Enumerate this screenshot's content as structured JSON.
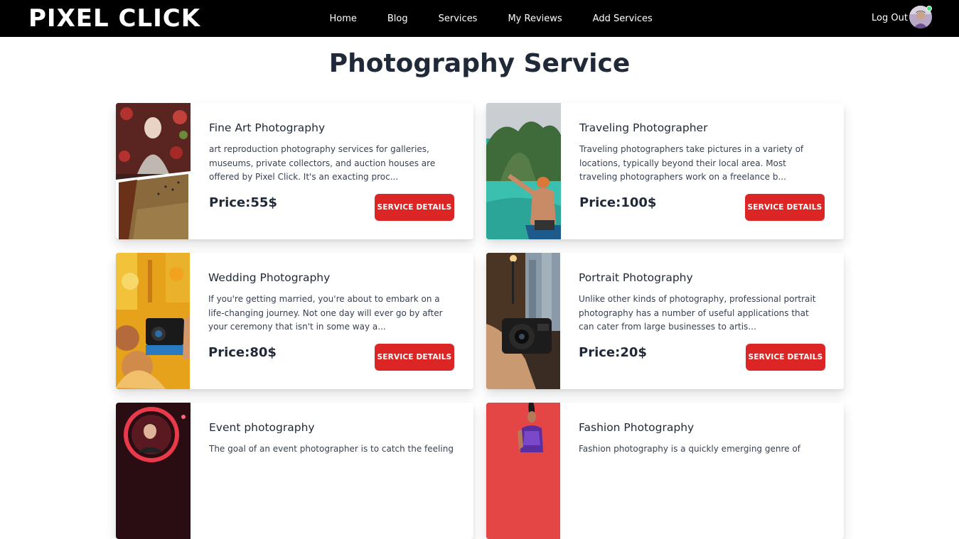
{
  "navbar": {
    "logo": "PiXEL CLiCK",
    "links": [
      "Home",
      "Blog",
      "Services",
      "My Reviews",
      "Add Services"
    ],
    "logout": "Log Out"
  },
  "page": {
    "title": "Photography Service"
  },
  "services": [
    {
      "title": "Fine Art Photography",
      "description": "art reproduction photography services for galleries, museums, private collectors, and auction houses are offered by Pixel Click. It's an exacting proc...",
      "price": "Price:55$",
      "button": "SERVICE DETAILS"
    },
    {
      "title": "Traveling Photographer",
      "description": "Traveling photographers take pictures in a variety of locations, typically beyond their local area. Most traveling photographers work on a freelance b...",
      "price": "Price:100$",
      "button": "SERVICE DETAILS"
    },
    {
      "title": "Wedding Photography",
      "description": "If you're getting married, you're about to embark on a life-changing journey. Not one day will ever go by after your ceremony that isn't in some way a...",
      "price": "Price:80$",
      "button": "SERVICE DETAILS"
    },
    {
      "title": "Portrait Photography",
      "description": "Unlike other kinds of photography, professional portrait photography has a number of useful applications that can cater from large businesses to artis...",
      "price": "Price:20$",
      "button": "SERVICE DETAILS"
    },
    {
      "title": "Event photography",
      "description": "The goal of an event photographer is to catch the feeling",
      "price": "",
      "button": ""
    },
    {
      "title": "Fashion Photography",
      "description": "Fashion photography is a quickly emerging genre of",
      "price": "",
      "button": ""
    }
  ],
  "colors": {
    "navbar": "#000000",
    "accent": "#dc2626",
    "text": "#1f2937"
  }
}
